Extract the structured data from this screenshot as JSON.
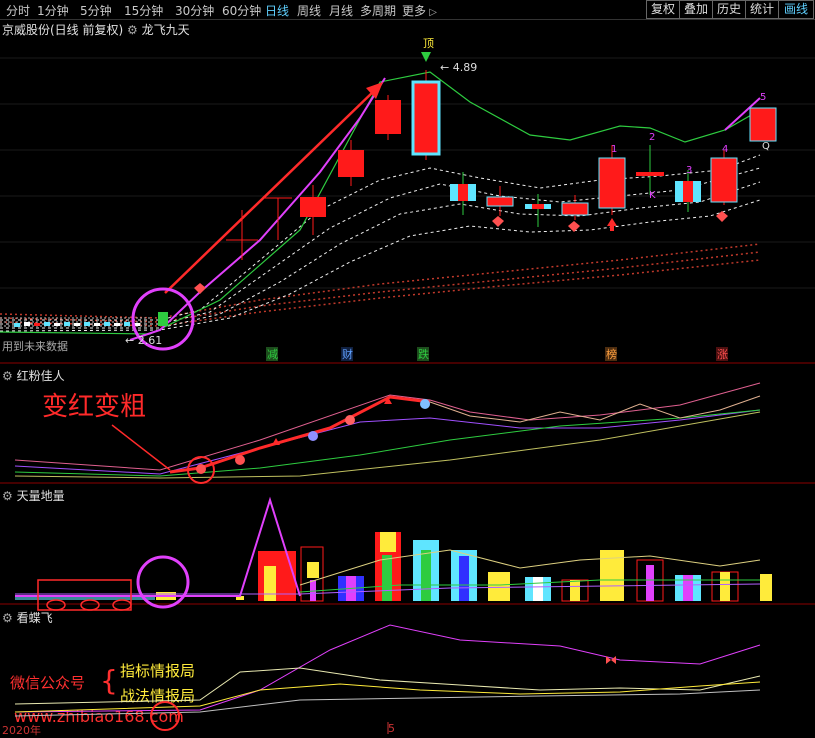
{
  "toolbar": {
    "timeframes": [
      "分时",
      "1分钟",
      "5分钟",
      "15分钟",
      "30分钟",
      "60分钟",
      "日线",
      "周线",
      "月线",
      "多周期",
      "更多"
    ],
    "active_timeframe": "日线",
    "right_buttons": [
      "复权",
      "叠加",
      "历史",
      "统计",
      "画线"
    ],
    "active_right_button": "画线"
  },
  "main_panel": {
    "title": "京威股份(日线 前复权)",
    "indicator": "龙飞九天",
    "price_high_label": "4.89",
    "price_low_label": "2.61",
    "top_marker": "顶",
    "future_data_text": "用到未来数据",
    "bottom_signals": [
      "减",
      "财",
      "跌",
      "榜",
      "涨"
    ],
    "count_labels": [
      "1",
      "2",
      "3",
      "4",
      "5"
    ],
    "letter_labels": [
      "K",
      "Q"
    ]
  },
  "panel2": {
    "title": "红粉佳人",
    "annotation": "变红变粗"
  },
  "panel3": {
    "title": "天量地量"
  },
  "panel4": {
    "title": "看蝶飞"
  },
  "watermark": {
    "label": "微信公众号",
    "line1": "指标情报局",
    "line2": "战法情报局",
    "url": "www.zhibiao168.com"
  },
  "axis": {
    "year_label": "2020年",
    "month_label": "5"
  },
  "colors": {
    "active": "#5fd0ff",
    "up": "#ff1a1a",
    "down": "#5fe5ff",
    "magenta": "#e040fb",
    "green": "#3bd13b"
  }
}
